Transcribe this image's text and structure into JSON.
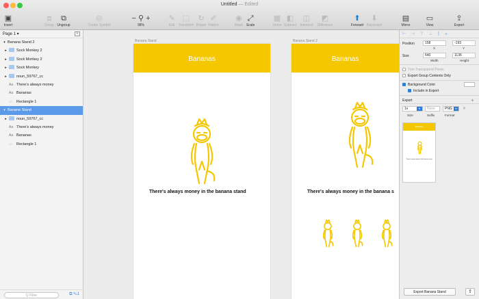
{
  "window": {
    "title": "Untitled",
    "status": "— Edited"
  },
  "toolbar": {
    "insert": "Insert",
    "group": "Group",
    "ungroup": "Ungroup",
    "create_symbol": "Create Symbol",
    "zoom_minus": "−",
    "zoom_plus": "+",
    "zoom_value": "98%",
    "edit": "Edit",
    "transform": "Transform",
    "rotate": "Rotate",
    "flatten": "Flatten",
    "mask": "Mask",
    "scale": "Scale",
    "union": "Union",
    "subtract": "Subtract",
    "intersect": "Intersect",
    "difference": "Difference",
    "forward": "Forward",
    "backward": "Backward",
    "mirror": "Mirror",
    "view": "View",
    "export": "Export"
  },
  "sidebar": {
    "page": "Page 1 ▾",
    "page_add": "+",
    "layers": [
      {
        "label": "Banana Stand 2",
        "kind": "artboard",
        "indent": 0,
        "glyph": "▾"
      },
      {
        "label": "Sock Monkey 2",
        "kind": "group",
        "indent": 1,
        "glyph": "▸"
      },
      {
        "label": "Sock Monkey 2",
        "kind": "group",
        "indent": 1,
        "glyph": "▸"
      },
      {
        "label": "Sock Monkey",
        "kind": "group",
        "indent": 1,
        "glyph": "▸"
      },
      {
        "label": "noun_59767_cc",
        "kind": "group",
        "indent": 1,
        "glyph": "▸"
      },
      {
        "label": "There's always money",
        "kind": "text",
        "indent": 1,
        "glyph": ""
      },
      {
        "label": "Bananas",
        "kind": "text",
        "indent": 1,
        "glyph": ""
      },
      {
        "label": "Rectangle 1",
        "kind": "rect",
        "indent": 1,
        "glyph": ""
      },
      {
        "label": "Banana Stand",
        "kind": "artboard",
        "indent": 0,
        "glyph": "▾",
        "selected": true
      },
      {
        "label": "noun_59767_cc",
        "kind": "group",
        "indent": 1,
        "glyph": "▸"
      },
      {
        "label": "There's always money",
        "kind": "text",
        "indent": 1,
        "glyph": ""
      },
      {
        "label": "Bananas",
        "kind": "text",
        "indent": 1,
        "glyph": ""
      },
      {
        "label": "Rectangle 1",
        "kind": "rect",
        "indent": 1,
        "glyph": ""
      }
    ],
    "filter_placeholder": "Q  Filter",
    "filter_icons": "⧉ ✎1"
  },
  "canvas": {
    "artboard1": {
      "label": "Banana Stand",
      "header": "Bananas",
      "tagline": "There's always money in the banana stand"
    },
    "artboard2": {
      "label": "Banana Stand 2",
      "header": "Bananas",
      "tagline": "There's always money in the banana s"
    }
  },
  "inspector": {
    "align_icons": "⊢ ⊣ ⊤ ⊥ ⫿ ⟛",
    "position_label": "Position",
    "x": "158",
    "y": "-193",
    "x_sub": "X",
    "y_sub": "Y",
    "size_label": "Size",
    "width": "640",
    "height": "1136",
    "w_sub": "Width",
    "h_sub": "Height",
    "trim_label": "Trim Transparent Pixels",
    "export_group_label": "Export Group Contents Only",
    "bg_color_label": "Background Color",
    "include_label": "Include in Export",
    "export_label": "Export",
    "export_add": "+",
    "export_size": "1x",
    "export_suffix": "None",
    "export_format": "PNG",
    "size_sub": "Size",
    "suffix_sub": "Suffix",
    "format_sub": "Format",
    "export_remove": "✕",
    "thumb_header": "Bananas",
    "thumb_tagline": "There's always money in the banana stand",
    "export_button": "Export Banana Stand",
    "share_icon": "⇪"
  },
  "colors": {
    "accent_yellow": "#f5c700",
    "selection_blue": "#5a9ae8",
    "link_blue": "#2f7fd9"
  }
}
